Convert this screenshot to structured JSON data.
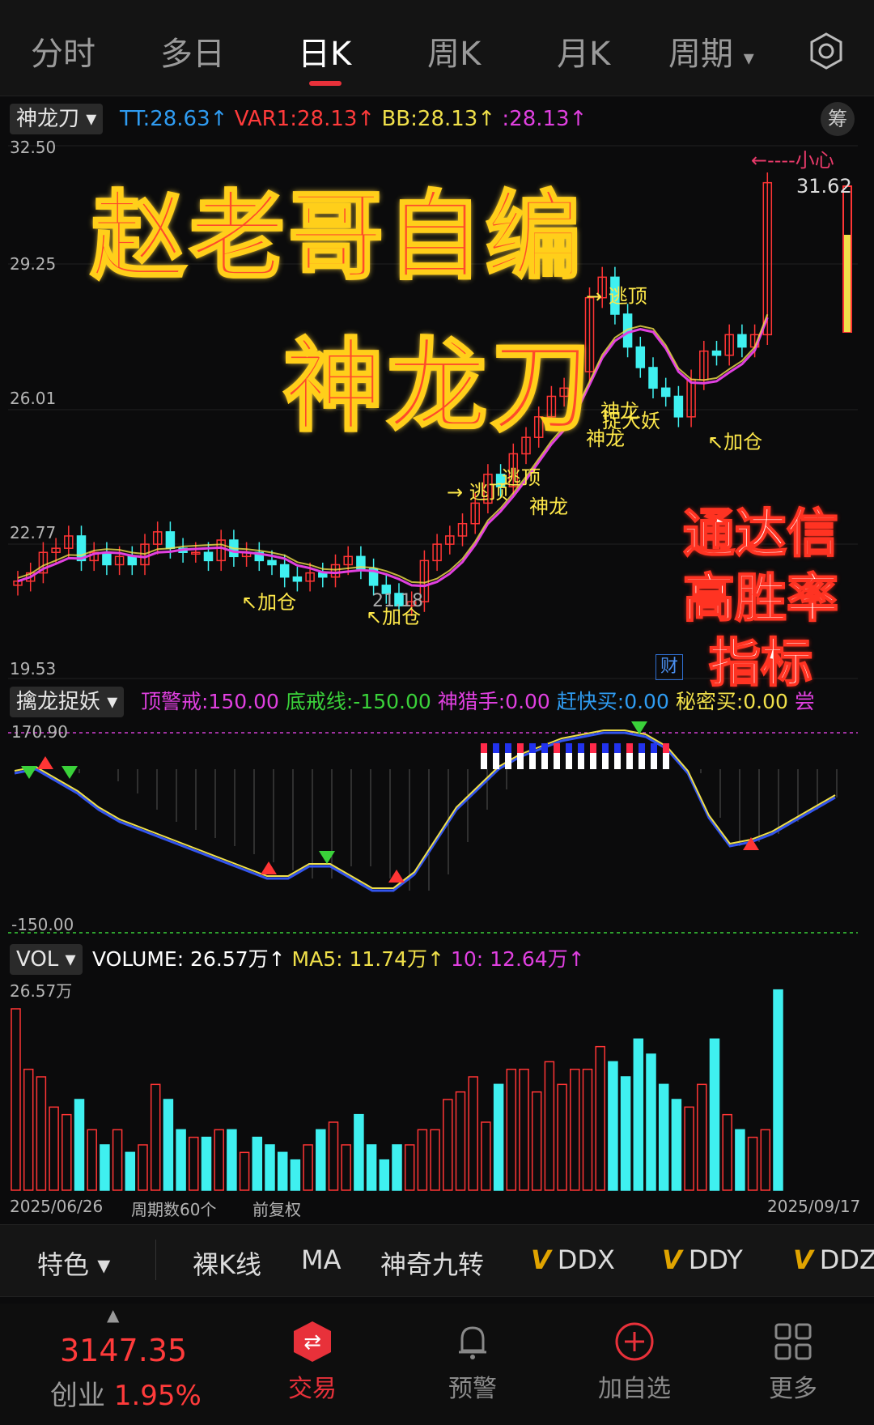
{
  "tabs": [
    "分时",
    "多日",
    "日K",
    "周K",
    "月K",
    "周期"
  ],
  "active_tab": "日K",
  "main_indicator": {
    "name": "神龙刀",
    "values": [
      {
        "label": "TT:28.63↑",
        "color": "#2f9cf2"
      },
      {
        "label": "VAR1:28.13↑",
        "color": "#ff3b3b"
      },
      {
        "label": "BB:28.13↑",
        "color": "#f0e04a"
      },
      {
        "label": ":28.13↑",
        "color": "#e040e0"
      }
    ],
    "chip_button": "筹",
    "y_ticks": [
      "32.50",
      "29.25",
      "26.01",
      "22.77",
      "19.53"
    ],
    "last_price": "31.62",
    "low_mark": "21.18",
    "caution_label": "←----小心",
    "cai_badge": "财"
  },
  "signals": {
    "jiacang": "加仓",
    "taoding": "逃顶",
    "shenlong": "神龙",
    "zhuoyao": "捉大妖"
  },
  "overlay": {
    "title_line1": "赵老哥自编",
    "title_line2": "神龙刀",
    "side_line1": "通达信",
    "side_line2": "高胜率",
    "side_line3": "指标"
  },
  "sub_indicator": {
    "name": "擒龙捉妖",
    "values": [
      {
        "label": "顶警戒:150.00",
        "color": "#e040e0"
      },
      {
        "label": "底戒线:-150.00",
        "color": "#3ad13a"
      },
      {
        "label": "神猎手:0.00",
        "color": "#e040e0"
      },
      {
        "label": "赶快买:0.00",
        "color": "#2f9cf2"
      },
      {
        "label": "秘密买:0.00",
        "color": "#f0e04a"
      },
      {
        "label": "尝",
        "color": "#e040e0"
      }
    ],
    "y_top": "170.90",
    "y_bottom": "-150.00"
  },
  "volume": {
    "name": "VOL",
    "values": [
      {
        "label": "VOLUME: 26.57万↑",
        "color": "#ffffff"
      },
      {
        "label": "MA5: 11.74万↑",
        "color": "#f0e04a"
      },
      {
        "label": "10: 12.64万↑",
        "color": "#e040e0"
      }
    ],
    "y_top": "26.57万",
    "date_start": "2025/06/26",
    "period_count": "周期数60个",
    "adjust": "前复权",
    "date_end": "2025/09/17"
  },
  "bottom_tools": {
    "special": "特色",
    "items": [
      "裸K线",
      "MA",
      "神奇九转"
    ],
    "v_items": [
      "DDX",
      "DDY",
      "DDZ"
    ]
  },
  "nav": {
    "index_value": "3147.35",
    "index_name": "创业",
    "index_change": "1.95%",
    "items": [
      "交易",
      "预警",
      "加自选",
      "更多"
    ]
  },
  "colors": {
    "up": "#ff3535",
    "down": "#3ff0f0",
    "accent": "#e8313a",
    "magenta": "#e040e0",
    "yellow": "#f0e04a"
  }
}
